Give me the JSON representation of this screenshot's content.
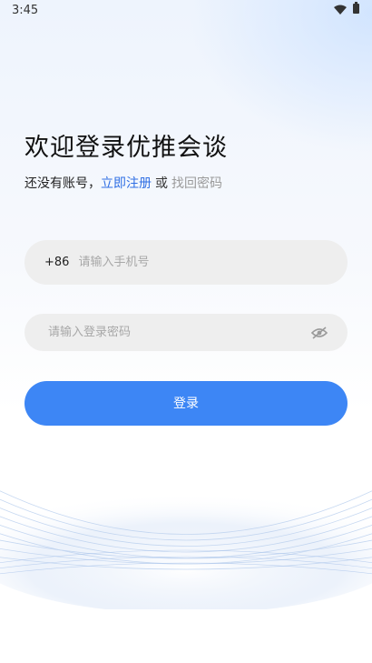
{
  "status_bar": {
    "time": "3:45"
  },
  "login": {
    "title": "欢迎登录优推会谈",
    "no_account_text": "还没有账号，",
    "register_link": "立即注册",
    "or_text": "或",
    "recover_link": "找回密码",
    "phone": {
      "country_code": "+86",
      "placeholder": "请输入手机号",
      "value": ""
    },
    "password": {
      "placeholder": "请输入登录密码",
      "value": ""
    },
    "login_button": "登录"
  },
  "icons": {
    "wifi": "wifi-icon",
    "battery": "battery-icon",
    "eye_off": "eye-off-icon"
  },
  "colors": {
    "primary": "#3d86f5",
    "link": "#2f6fe4",
    "field_bg": "#eeeeee"
  }
}
